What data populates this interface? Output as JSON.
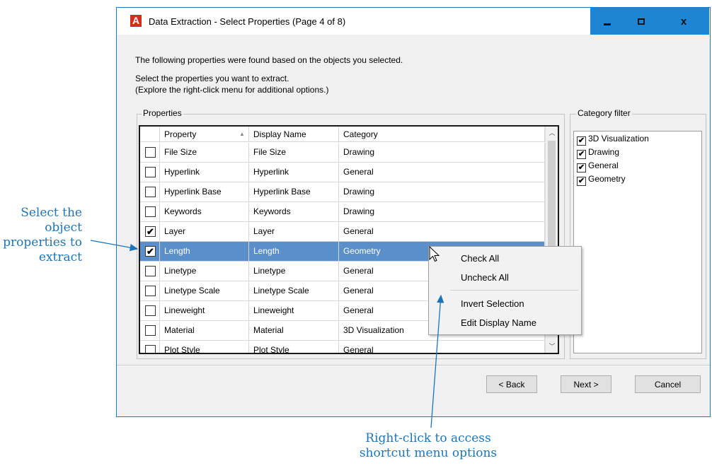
{
  "window": {
    "title": "Data Extraction - Select Properties (Page 4 of 8)",
    "app_icon_letter": "A",
    "close_glyph": "x"
  },
  "intro": {
    "line1": "The following properties were found based on the objects you selected.",
    "line2": "Select the properties you want to extract.",
    "line3": "(Explore the right-click menu for additional options.)"
  },
  "properties": {
    "group_label": "Properties",
    "headers": [
      "Property",
      "Display Name",
      "Category"
    ],
    "rows": [
      {
        "checked": false,
        "property": "File Size",
        "display": "File Size",
        "category": "Drawing"
      },
      {
        "checked": false,
        "property": "Hyperlink",
        "display": "Hyperlink",
        "category": "General"
      },
      {
        "checked": false,
        "property": "Hyperlink Base",
        "display": "Hyperlink Base",
        "category": "Drawing"
      },
      {
        "checked": false,
        "property": "Keywords",
        "display": "Keywords",
        "category": "Drawing"
      },
      {
        "checked": true,
        "property": "Layer",
        "display": "Layer",
        "category": "General"
      },
      {
        "checked": true,
        "property": "Length",
        "display": "Length",
        "category": "Geometry",
        "selected": true
      },
      {
        "checked": false,
        "property": "Linetype",
        "display": "Linetype",
        "category": "General"
      },
      {
        "checked": false,
        "property": "Linetype Scale",
        "display": "Linetype Scale",
        "category": "General"
      },
      {
        "checked": false,
        "property": "Lineweight",
        "display": "Lineweight",
        "category": "General"
      },
      {
        "checked": false,
        "property": "Material",
        "display": "Material",
        "category": "3D Visualization"
      },
      {
        "checked": false,
        "property": "Plot Style",
        "display": "Plot Style",
        "category": "General"
      }
    ]
  },
  "category_filter": {
    "label": "Category filter",
    "items": [
      {
        "label": "3D Visualization",
        "checked": true
      },
      {
        "label": "Drawing",
        "checked": true
      },
      {
        "label": "General",
        "checked": true
      },
      {
        "label": "Geometry",
        "checked": true
      }
    ]
  },
  "context_menu": {
    "items": [
      "Check All",
      "Uncheck All",
      "Invert Selection",
      "Edit Display Name"
    ]
  },
  "buttons": {
    "back": "< Back",
    "next": "Next >",
    "cancel": "Cancel"
  },
  "annotations": {
    "left": "Select the object properties to extract",
    "bottom_line1": "Right-click to access",
    "bottom_line2": "shortcut menu options"
  },
  "colors": {
    "title_bar_buttons": "#1e84d4",
    "selected_row": "#5b8fc9",
    "annotation": "#1d74b8",
    "app_icon": "#d92a22"
  }
}
